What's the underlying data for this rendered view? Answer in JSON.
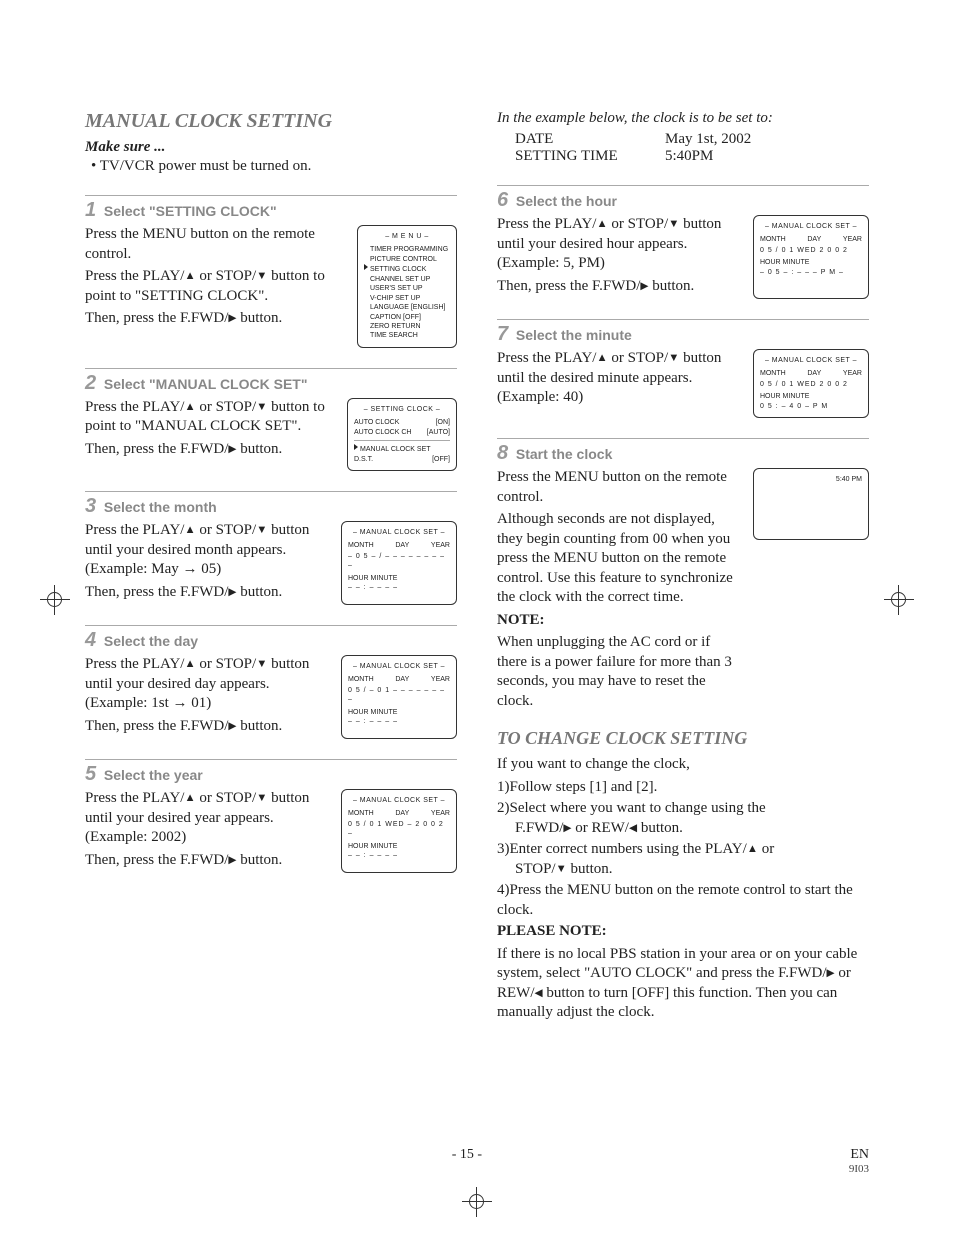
{
  "title": "MANUAL CLOCK SETTING",
  "make_sure": {
    "head": "Make sure ...",
    "item": "• TV/VCR power must be turned on."
  },
  "example": {
    "intro": "In the example below, the clock is to be set to:",
    "date_label": "DATE",
    "date_value": "May 1st, 2002",
    "time_label": "SETTING TIME",
    "time_value": "5:40PM"
  },
  "steps": {
    "s1": {
      "num": "1",
      "title": "Select \"SETTING CLOCK\"",
      "p1": "Press the MENU button on the remote control.",
      "p2_a": "Press the PLAY/",
      "p2_b": " or STOP/",
      "p2_c": " button to point to \"SETTING CLOCK\".",
      "p3_a": "Then, press the F.FWD/",
      "p3_b": " button.",
      "osd": {
        "title": "– M E N U –",
        "items": [
          "TIMER PROGRAMMING",
          "PICTURE CONTROL",
          "SETTING CLOCK",
          "CHANNEL SET UP",
          "USER'S SET UP",
          "V-CHIP SET UP",
          "LANGUAGE   [ENGLISH]",
          "CAPTION   [OFF]",
          "ZERO RETURN",
          "TIME SEARCH"
        ],
        "cursor_index": 2
      }
    },
    "s2": {
      "num": "2",
      "title": "Select \"MANUAL CLOCK SET\"",
      "p1_a": "Press the PLAY/",
      "p1_b": " or STOP/",
      "p1_c": " button to point to \"MANUAL CLOCK SET\".",
      "p2_a": "Then, press the F.FWD/",
      "p2_b": " button.",
      "osd": {
        "title": "– SETTING CLOCK –",
        "r1": {
          "l": "AUTO CLOCK",
          "r": "[ON]"
        },
        "r2": {
          "l": "AUTO CLOCK CH",
          "r": "[AUTO]"
        },
        "r3": {
          "l": "MANUAL CLOCK SET",
          "r": ""
        },
        "r4": {
          "l": "D.S.T.",
          "r": "[OFF]"
        }
      }
    },
    "s3": {
      "num": "3",
      "title": "Select the month",
      "p1_a": "Press the PLAY/",
      "p1_b": " or STOP/",
      "p1_c": " button until your desired month appears. (Example: May → 05)",
      "p2_a": "Then, press the F.FWD/",
      "p2_b": " button.",
      "osd": {
        "title": "– MANUAL CLOCK SET –",
        "mdy_labels": {
          "m": "MONTH",
          "d": "DAY",
          "y": "YEAR"
        },
        "mdy_vals": "– 0 5 – / – – – – –   – – – –",
        "hm_labels": "HOUR    MINUTE",
        "hm_vals": "– – : – –    – –",
        "hl": "05"
      }
    },
    "s4": {
      "num": "4",
      "title": "Select the day",
      "p1_a": "Press the PLAY/",
      "p1_b": " or STOP/",
      "p1_c": " button until your desired day appears. (Example: 1st → 01)",
      "p2_a": "Then, press the F.FWD/",
      "p2_b": " button.",
      "osd": {
        "title": "– MANUAL CLOCK SET –",
        "mdy_vals": "0 5  /  – 0 1 – – – –   – – – –",
        "hm_vals": "– – : – –    – –",
        "hl": "01"
      }
    },
    "s5": {
      "num": "5",
      "title": "Select the year",
      "p1_a": "Press the PLAY/",
      "p1_b": " or STOP/",
      "p1_c": " button until your desired year appears. (Example: 2002)",
      "p2_a": "Then, press the F.FWD/",
      "p2_b": " button.",
      "osd": {
        "title": "– MANUAL CLOCK SET –",
        "mdy_vals": "0 5  /  0 1  WED – 2 0 0 2 –",
        "hm_vals": "– – : – –    – –",
        "hl": "2002"
      }
    },
    "s6": {
      "num": "6",
      "title": "Select the hour",
      "p1_a": "Press the PLAY/",
      "p1_b": " or STOP/",
      "p1_c": " button until your desired hour appears. (Example: 5, PM)",
      "p2_a": "Then, press the F.FWD/",
      "p2_b": " button.",
      "osd": {
        "title": "– MANUAL CLOCK SET –",
        "mdy_vals": "0 5  /  0 1  WED  2 0 0 2",
        "hm_vals": "– 0 5 – : – –    – P M –",
        "hl": "05"
      }
    },
    "s7": {
      "num": "7",
      "title": "Select the minute",
      "p1_a": "Press the PLAY/",
      "p1_b": " or STOP/",
      "p1_c": " button until the desired minute appears. (Example: 40)",
      "osd": {
        "title": "– MANUAL CLOCK SET –",
        "mdy_vals": "0 5  /  0 1  WED  2 0 0 2",
        "hm_vals": "0 5 : – 4 0 –    P M",
        "hl": "40"
      }
    },
    "s8": {
      "num": "8",
      "title": "Start the clock",
      "p1": "Press the MENU button on the remote control.",
      "p2": "Although seconds are not displayed, they begin counting from 00 when you press the MENU button on the remote control. Use this feature to synchronize the clock with the correct time.",
      "note_head": "NOTE:",
      "note_body": "When unplugging the AC cord or if there is a power failure for more than 3 seconds, you may have to reset the clock.",
      "osd": {
        "corner": "5:40 PM"
      }
    }
  },
  "change": {
    "title": "TO CHANGE CLOCK SETTING",
    "intro": "If you want to change the clock,",
    "items": [
      {
        "n": "1)",
        "t": "Follow steps [1] and [2]."
      },
      {
        "n": "2)",
        "t": "Select where you want to change using the",
        "sub_a": "F.FWD/",
        "sub_b": " or REW/",
        "sub_c": " button."
      },
      {
        "n": "3)",
        "t_a": "Enter correct numbers using the PLAY/",
        "t_b": " or",
        "sub_a": "STOP/",
        "sub_b": " button."
      },
      {
        "n": "4)",
        "t": "Press the MENU button on the remote control to start the clock."
      }
    ],
    "please_note_head": "PLEASE NOTE:",
    "please_note_a": "If there is no local PBS station in your area or on your cable system, select \"AUTO CLOCK\" and press the F.FWD/",
    "please_note_b": " or REW/",
    "please_note_c": " button to turn [OFF] this function. Then you can manually adjust the clock."
  },
  "footer": {
    "page": "- 15 -",
    "lang": "EN",
    "code": "9I03"
  },
  "mdy_labels": {
    "m": "MONTH",
    "d": "DAY",
    "y": "YEAR"
  },
  "hm_labels": "HOUR    MINUTE"
}
